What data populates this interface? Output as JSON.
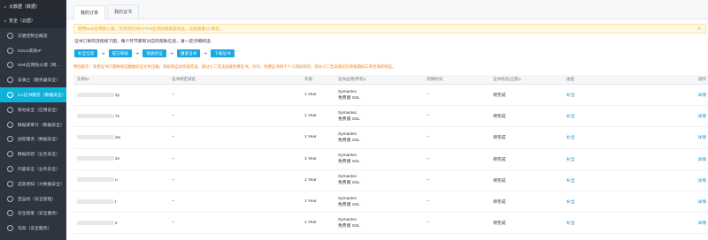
{
  "sidebar": {
    "groups": [
      {
        "label": "大数据（数据）",
        "caret": "▸"
      },
      {
        "label": "安全（云盾）",
        "caret": "▾"
      }
    ],
    "items": [
      {
        "label": "云盾控制台概览"
      },
      {
        "label": "DDoS高防IP"
      },
      {
        "label": "Web应用防火墙（网..."
      },
      {
        "label": "安骑士（服务器安全）"
      },
      {
        "label": "CA证书服务（数据安全）"
      },
      {
        "label": "移动安全（应用安全）"
      },
      {
        "label": "数据库审计（数据安全）"
      },
      {
        "label": "加密服务（数据安全）"
      },
      {
        "label": "数据风控（业务安全）"
      },
      {
        "label": "内容安全（业务安全）"
      },
      {
        "label": "态势感知（大数据安全）"
      },
      {
        "label": "堡垒机（安全管理）"
      },
      {
        "label": "安全管家（安全服务）"
      },
      {
        "label": "先知（安全服务）"
      }
    ],
    "active_index": 4
  },
  "tabs": [
    {
      "label": "我的订单",
      "active": true
    },
    {
      "label": "我的证书",
      "active": false
    }
  ],
  "notice": {
    "text": "使用Web应用防火墙，可有效针对HTTPS业务防御黑客攻击，过滤海量CC请求。",
    "close": "✕"
  },
  "flow": {
    "label": "证书订单的流程如下图，每个环节都有对应的帮助信息，请一定仔细阅读：",
    "steps": [
      "补全信息",
      "提交审核",
      "资质验证",
      "颁发证书",
      "下载证书"
    ],
    "arrow": "➜"
  },
  "warning": "特别提示：免费证书只需要保证数据验证文件正确；系统将自动完成签发。部分小二无法加速免费证书。另外，免费证书用于个人测试目的，部分小二无法保证在审核期间工单咨询的响应。",
  "table": {
    "headers": [
      "实例ID",
      "证书绑定域名",
      "年限",
      "证书品牌(所有)",
      "到期时间",
      "证书状态(全部)",
      "进度",
      "操作"
    ],
    "sort_icon": "▾",
    "rows": [
      {
        "id_suffix": "2y",
        "domain": "--",
        "years": "1 Year",
        "brand": "Symantec",
        "type": "免费版 SSL",
        "expire": "--",
        "status": "待完成",
        "progress": "补全",
        "action": "详情"
      },
      {
        "id_suffix": "7x",
        "domain": "--",
        "years": "1 Year",
        "brand": "Symantec",
        "type": "免费版 SSL",
        "expire": "--",
        "status": "待完成",
        "progress": "补全",
        "action": "详情"
      },
      {
        "id_suffix": "2w",
        "domain": "--",
        "years": "1 Year",
        "brand": "Symantec",
        "type": "免费版 SSL",
        "expire": "--",
        "status": "待完成",
        "progress": "补全",
        "action": "详情"
      },
      {
        "id_suffix": "2v",
        "domain": "--",
        "years": "1 Year",
        "brand": "Symantec",
        "type": "免费版 SSL",
        "expire": "--",
        "status": "待完成",
        "progress": "补全",
        "action": "详情"
      },
      {
        "id_suffix": "u",
        "domain": "--",
        "years": "1 Year",
        "brand": "Symantec",
        "type": "免费版 SSL",
        "expire": "--",
        "status": "待完成",
        "progress": "补全",
        "action": "详情"
      },
      {
        "id_suffix": "t",
        "domain": "--",
        "years": "1 Year",
        "brand": "Symantec",
        "type": "免费版 SSL",
        "expire": "--",
        "status": "待完成",
        "progress": "补全",
        "action": "详情"
      },
      {
        "id_suffix": "s",
        "domain": "--",
        "years": "1 Year",
        "brand": "Symantec",
        "type": "免费版 SSL",
        "expire": "--",
        "status": "待完成",
        "progress": "补全",
        "action": "详情"
      }
    ]
  },
  "colors": {
    "accent": "#0fb3d9",
    "step": "#1aa7e0",
    "warning": "#f08020",
    "notice": "#f0a020",
    "link": "#1a8fd0"
  }
}
